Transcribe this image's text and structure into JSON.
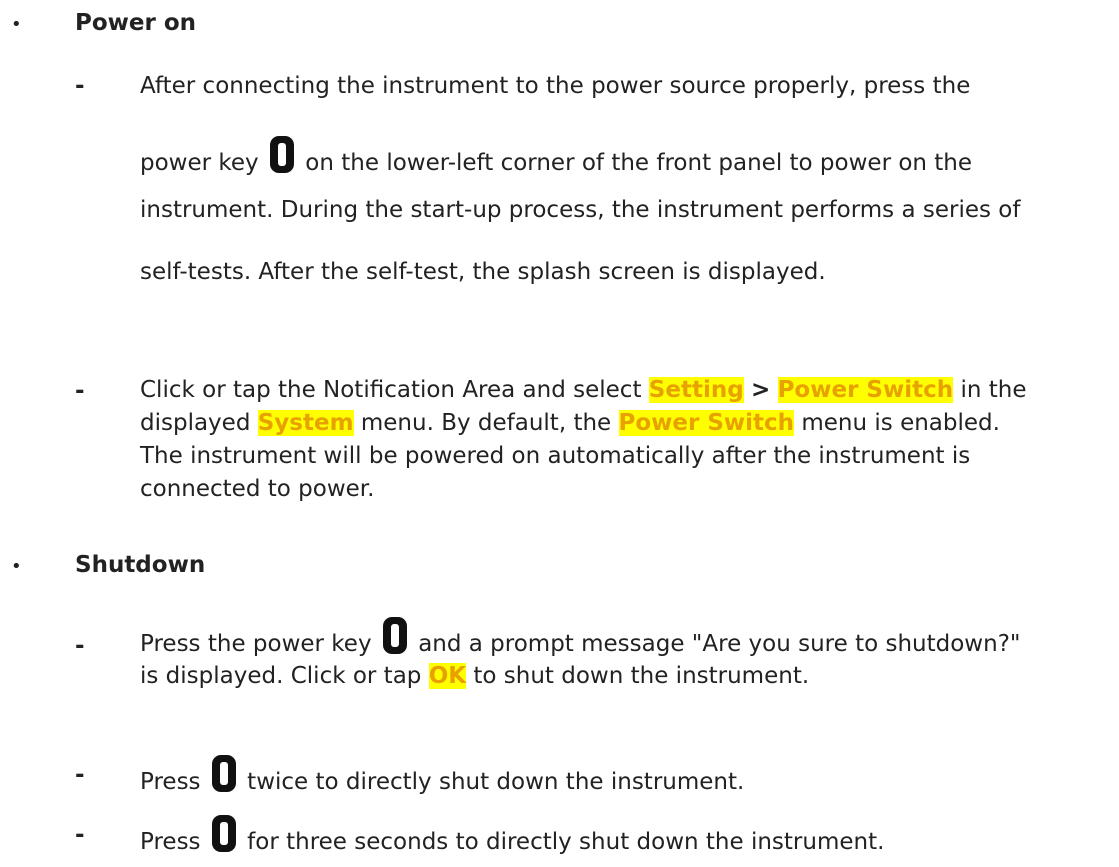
{
  "power_on": {
    "heading": "Power on",
    "item1": {
      "l1": "After connecting the instrument to the power source properly, press the",
      "l2a": "power key",
      "l2b": "on the lower-left corner of the front panel to power on the",
      "l3": "instrument. During the start-up process, the instrument performs a series of",
      "l4": "self-tests. After the self-test, the splash screen is displayed."
    },
    "item2": {
      "a": "Click or tap the Notification Area and select",
      "setting": "Setting",
      "gt": ">",
      "power_switch": "Power Switch",
      "b": "in the",
      "c": "displayed",
      "system": "System",
      "d": "menu. By default, the",
      "power_switch2": "Power Switch",
      "e": "menu is enabled.",
      "f": "The instrument will be powered on automatically after the instrument is",
      "g": "connected to power."
    }
  },
  "shutdown": {
    "heading": "Shutdown",
    "item1": {
      "a": "Press the power key",
      "b": "and a prompt message \"Are you sure to shutdown?\"",
      "c": "is displayed. Click or tap",
      "ok": "OK",
      "d": "to shut down the instrument."
    },
    "item2": {
      "a": "Press",
      "b": "twice to directly shut down the instrument."
    },
    "item3": {
      "a": "Press",
      "b": "for three seconds to directly shut down the instrument."
    }
  },
  "bullet": "•",
  "dash": "-",
  "icons": {
    "power_key": "power-key-icon"
  }
}
